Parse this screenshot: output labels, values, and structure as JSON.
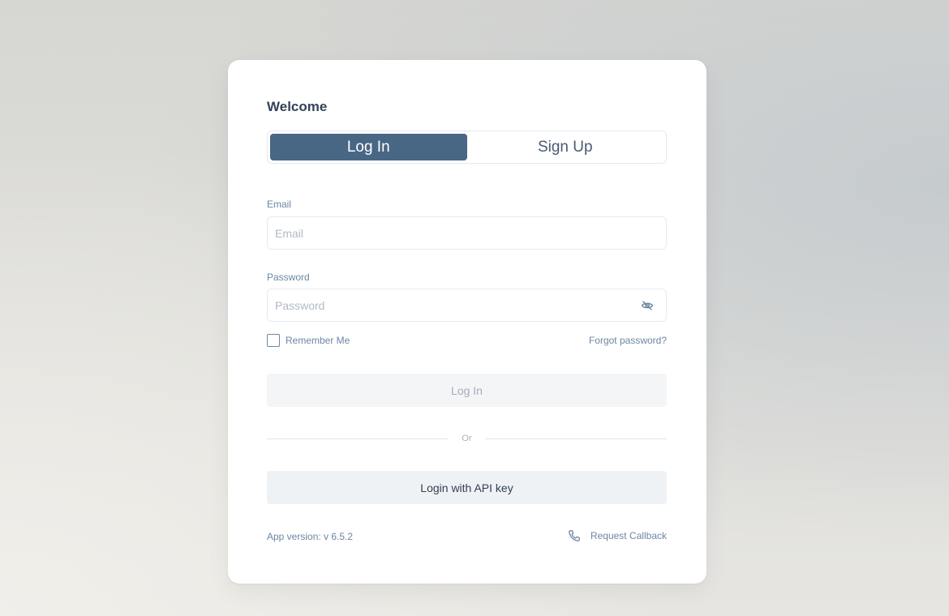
{
  "header": {
    "title": "Welcome"
  },
  "tabs": [
    {
      "label": "Log In",
      "active": true
    },
    {
      "label": "Sign Up",
      "active": false
    }
  ],
  "email": {
    "label": "Email",
    "placeholder": "Email",
    "value": ""
  },
  "password": {
    "label": "Password",
    "placeholder": "Password",
    "value": "",
    "toggle_icon": "eye-off-icon"
  },
  "remember": {
    "label": "Remember Me",
    "checked": false
  },
  "forgot": {
    "label": "Forgot password?"
  },
  "login_button": {
    "label": "Log In",
    "disabled": true
  },
  "divider": {
    "label": "Or"
  },
  "api_button": {
    "label": "Login with API key"
  },
  "footer": {
    "version": "App version: v 6.5.2",
    "callback_label": "Request Callback",
    "callback_icon": "phone-icon"
  },
  "colors": {
    "accent": "#486784",
    "link": "#6d86a3",
    "title": "#34425a"
  }
}
